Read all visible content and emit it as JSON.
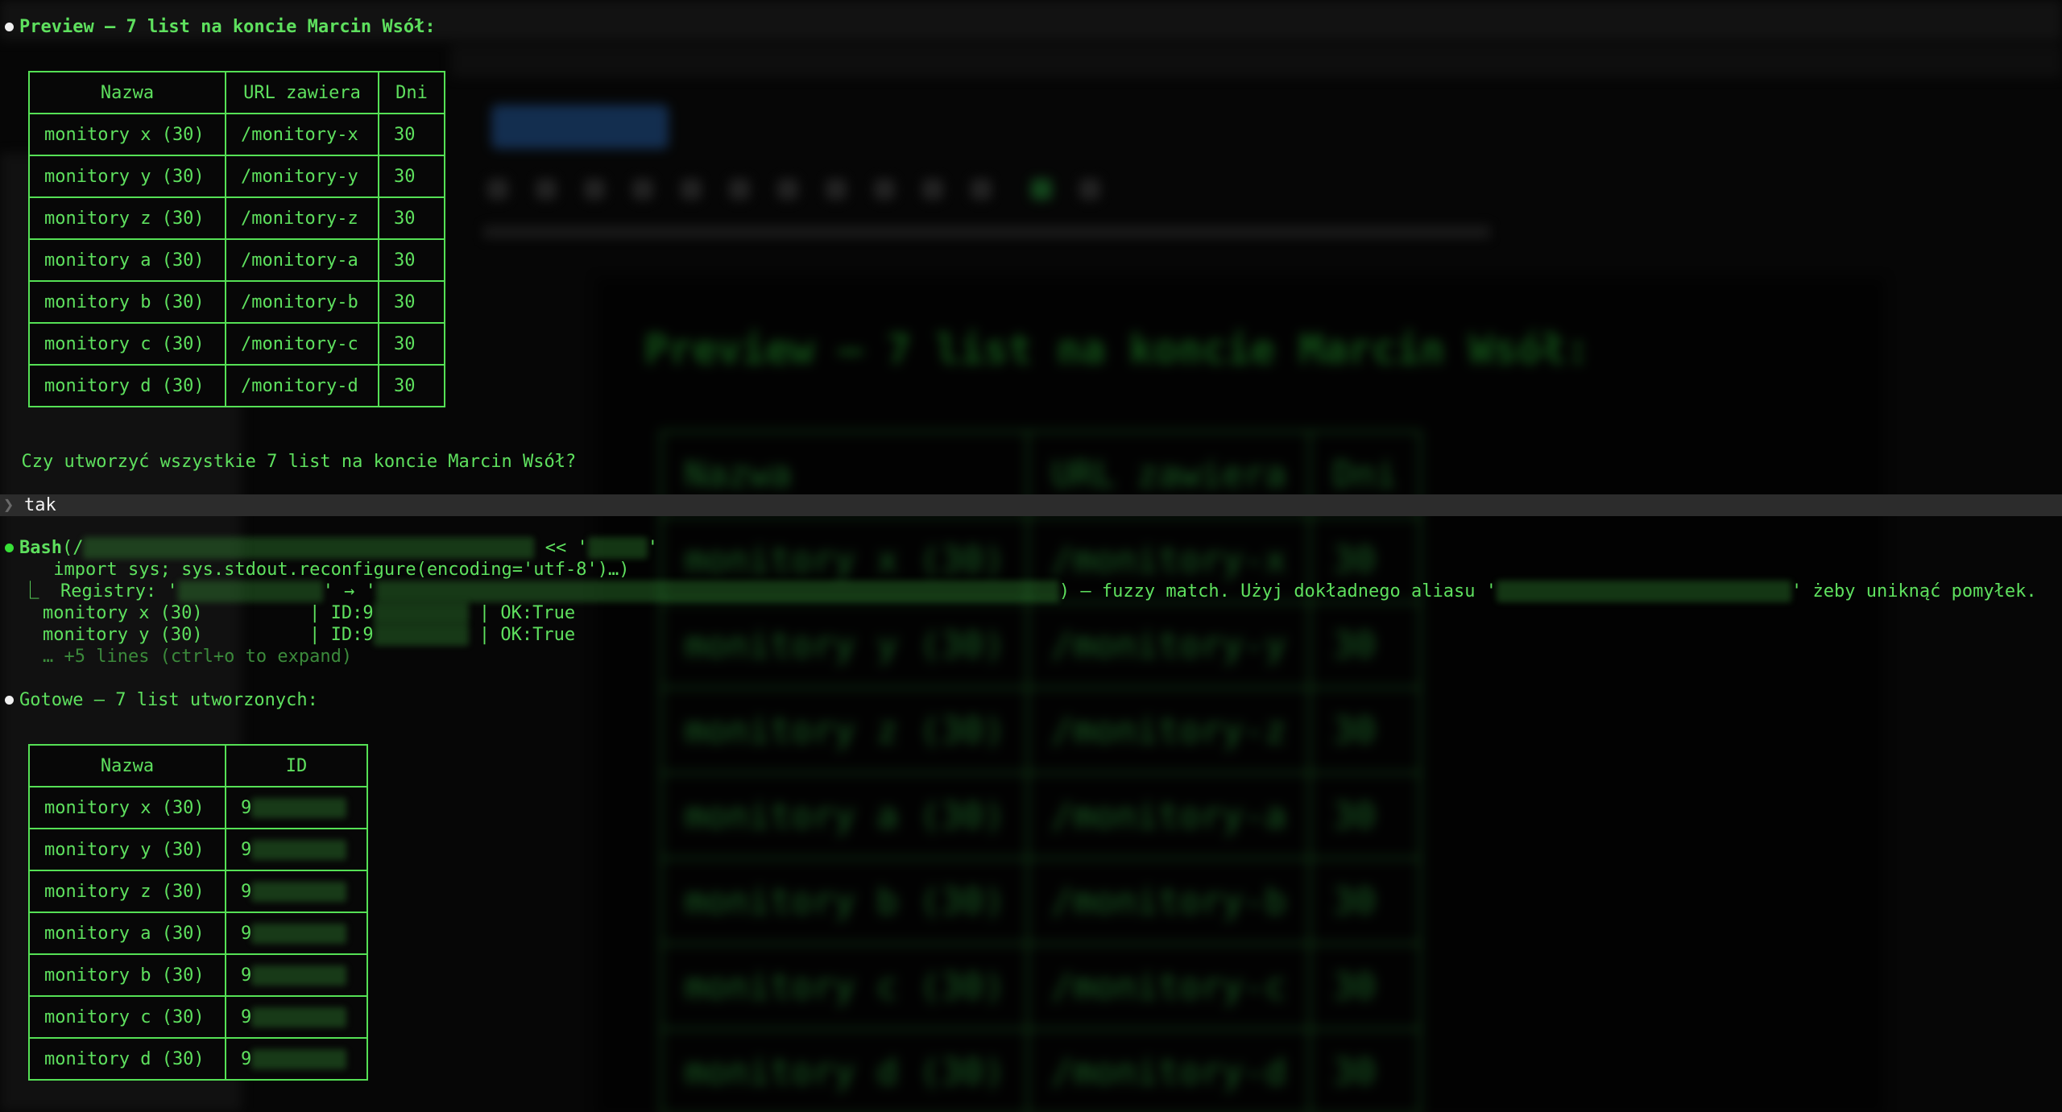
{
  "background_window": {
    "panel_title": "Preview — 7 list na koncie Marcin Wsół:",
    "panel_rows": [
      {
        "name": "Nazwa",
        "url": "URL zawiera",
        "days": "Dni"
      },
      {
        "name": "monitory x (30)",
        "url": "/monitory-x",
        "days": "30"
      },
      {
        "name": "monitory y (30)",
        "url": "/monitory-y",
        "days": "30"
      },
      {
        "name": "monitory z (30)",
        "url": "/monitory-z",
        "days": "30"
      },
      {
        "name": "monitory a (30)",
        "url": "/monitory-a",
        "days": "30"
      },
      {
        "name": "monitory b (30)",
        "url": "/monitory-b",
        "days": "30"
      },
      {
        "name": "monitory c (30)",
        "url": "/monitory-c",
        "days": "30"
      },
      {
        "name": "monitory d (30)",
        "url": "/monitory-d",
        "days": "30"
      }
    ]
  },
  "preview": {
    "heading": "Preview — 7 list na koncie Marcin Wsół:",
    "columns": [
      "Nazwa",
      "URL zawiera",
      "Dni"
    ],
    "rows": [
      {
        "name": "monitory x (30)",
        "url": "/monitory-x",
        "days": "30"
      },
      {
        "name": "monitory y (30)",
        "url": "/monitory-y",
        "days": "30"
      },
      {
        "name": "monitory z (30)",
        "url": "/monitory-z",
        "days": "30"
      },
      {
        "name": "monitory a (30)",
        "url": "/monitory-a",
        "days": "30"
      },
      {
        "name": "monitory b (30)",
        "url": "/monitory-b",
        "days": "30"
      },
      {
        "name": "monitory c (30)",
        "url": "/monitory-c",
        "days": "30"
      },
      {
        "name": "monitory d (30)",
        "url": "/monitory-d",
        "days": "30"
      }
    ],
    "question": "Czy utworzyć wszystkie 7 list na koncie Marcin Wsół?"
  },
  "input": {
    "prompt_icon": "chevron-right-icon",
    "value": "tak"
  },
  "bash": {
    "tool_label": "Bash",
    "paren_open": "(/",
    "heredoc": " << '",
    "heredoc_close": "'",
    "command_line": "import sys; sys.stdout.reconfigure(encoding='utf-8')…)",
    "registry_prefix": "⎿  Registry: '",
    "arrow": "' → '",
    "fuzzy_text": ") — fuzzy match. Użyj dokładnego aliasu '",
    "fuzzy_tail": "' żeby uniknąć pomyłek.",
    "result_lines": [
      {
        "name": "monitory x (30)",
        "id_prefix": "| ID:9",
        "ok": "| OK:True"
      },
      {
        "name": "monitory y (30)",
        "id_prefix": "| ID:9",
        "ok": "| OK:True"
      }
    ],
    "expand_hint": "… +5 lines (ctrl+o to expand)"
  },
  "done": {
    "heading": "Gotowe — 7 list utworzonych:",
    "columns": [
      "Nazwa",
      "ID"
    ],
    "rows": [
      {
        "name": "monitory x (30)",
        "id_prefix": "9"
      },
      {
        "name": "monitory y (30)",
        "id_prefix": "9"
      },
      {
        "name": "monitory z (30)",
        "id_prefix": "9"
      },
      {
        "name": "monitory a (30)",
        "id_prefix": "9"
      },
      {
        "name": "monitory b (30)",
        "id_prefix": "9"
      },
      {
        "name": "monitory c (30)",
        "id_prefix": "9"
      },
      {
        "name": "monitory d (30)",
        "id_prefix": "9"
      }
    ]
  },
  "colors": {
    "terminal_green": "#5ee05e",
    "bullet_white": "#f0f0f0",
    "bullet_green": "#37e037",
    "input_bar": "#2c2c2c"
  }
}
